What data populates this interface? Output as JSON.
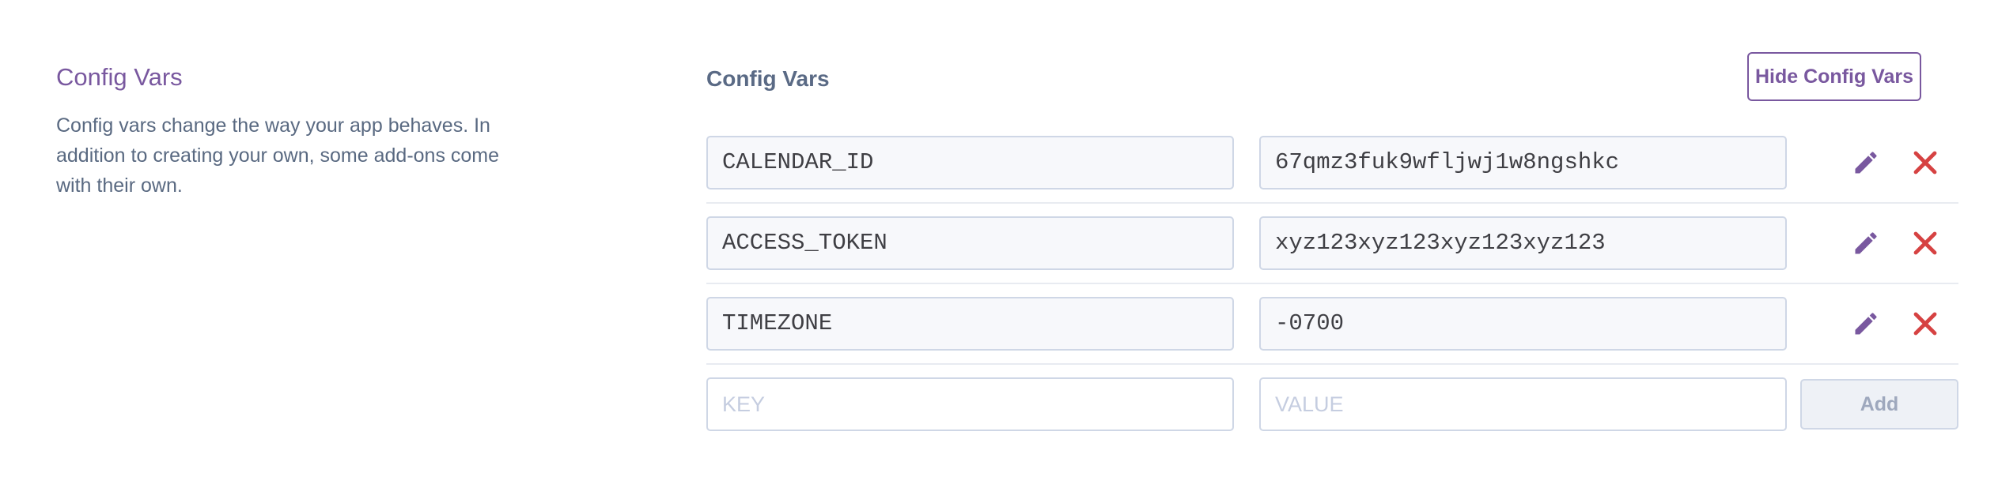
{
  "section": {
    "title": "Config Vars",
    "description": "Config vars change the way your app behaves. In addition to creating your own, some add-ons come with their own."
  },
  "panel": {
    "title": "Config Vars",
    "hide_button_label": "Hide Config Vars"
  },
  "config_vars": [
    {
      "key": "CALENDAR_ID",
      "value": "67qmz3fuk9wfljwj1w8ngshkc"
    },
    {
      "key": "ACCESS_TOKEN",
      "value": "xyz123xyz123xyz123xyz123"
    },
    {
      "key": "TIMEZONE",
      "value": "-0700"
    }
  ],
  "new_var": {
    "key_placeholder": "KEY",
    "value_placeholder": "VALUE",
    "add_label": "Add"
  },
  "icons": {
    "edit": "pencil-icon",
    "delete": "close-icon"
  },
  "colors": {
    "accent": "#79589f",
    "delete": "#d64242"
  }
}
